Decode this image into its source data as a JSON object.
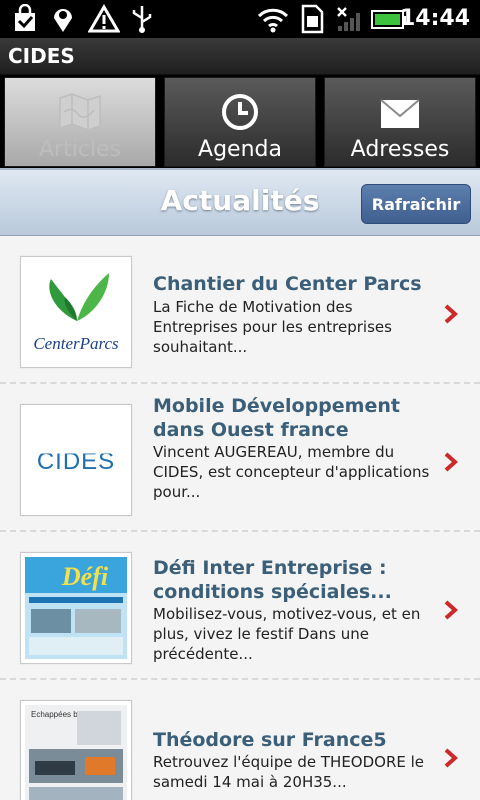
{
  "status_bar": {
    "time": "14:44",
    "icons": [
      "bag-icon",
      "location-pin-icon",
      "warning-icon",
      "usb-icon",
      "wifi-icon",
      "sim-icon",
      "no-signal-icon",
      "battery-icon"
    ]
  },
  "app": {
    "title": "CIDES"
  },
  "tabs": [
    {
      "label": "Articles",
      "icon": "map-icon",
      "selected": true
    },
    {
      "label": "Agenda",
      "icon": "clock-icon",
      "selected": false
    },
    {
      "label": "Adresses",
      "icon": "envelope-icon",
      "selected": false
    }
  ],
  "header": {
    "title": "Actualités",
    "refresh_label": "Rafraîchir"
  },
  "articles": [
    {
      "title": "Chantier du Center Parcs",
      "description": "La Fiche de Motivation des Entreprises pour les entreprises souhaitant...",
      "thumb_text": "CenterParcs"
    },
    {
      "title": "Mobile Développement dans Ouest france",
      "description": "Vincent AUGEREAU, membre du CIDES, est concepteur d'applications pour...",
      "thumb_text": "CIDES"
    },
    {
      "title": "Défi Inter Entreprise : conditions spéciales...",
      "description": "Mobilisez-vous, motivez-vous, et en plus, vivez le festif Dans une précédente...",
      "thumb_text": "Défi"
    },
    {
      "title": "Théodore sur France5",
      "description": "Retrouvez l'équipe de THEODORE le samedi 14 mai à 20H35...",
      "thumb_text": "Echappées belles"
    }
  ],
  "colors": {
    "accent": "#3b5f78",
    "chevron": "#cc2a2a",
    "button": "#4a6c9c"
  }
}
